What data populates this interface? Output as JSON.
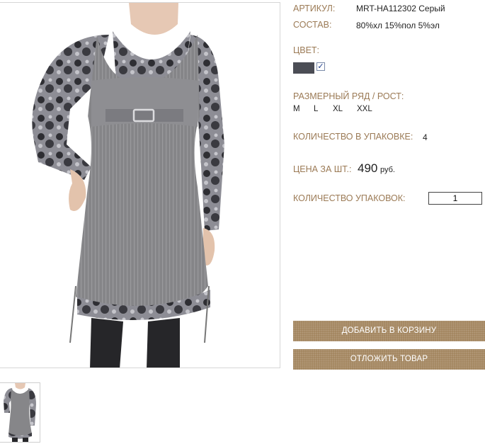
{
  "product": {
    "article_label": "АРТИКУЛ:",
    "article_value": "MRT-HA112302 Серый",
    "composition_label": "СОСТАВ:",
    "composition_value": "80%хл 15%пол 5%эл",
    "color_label": "ЦВЕТ:",
    "color_swatch": "#4b4d55",
    "color_checked_mark": "✓",
    "size_label": "РАЗМЕРНЫЙ РЯД / РОСТ:",
    "sizes": [
      "M",
      "L",
      "XL",
      "XXL"
    ],
    "pack_qty_label": "КОЛИЧЕСТВО В УПАКОВКЕ:",
    "pack_qty_value": "4",
    "price_label": "ЦЕНА ЗА ШТ.:",
    "price_value": "490",
    "price_currency": "руб.",
    "packs_label": "КОЛИЧЕСТВО УПАКОВОК:",
    "packs_value": "1"
  },
  "buttons": {
    "add_to_cart": "ДОБАВИТЬ В КОРЗИНУ",
    "save_item": "ОТЛОЖИТЬ ТОВАР"
  },
  "colors": {
    "label": "#9b7a55",
    "button": "#a0825a"
  }
}
